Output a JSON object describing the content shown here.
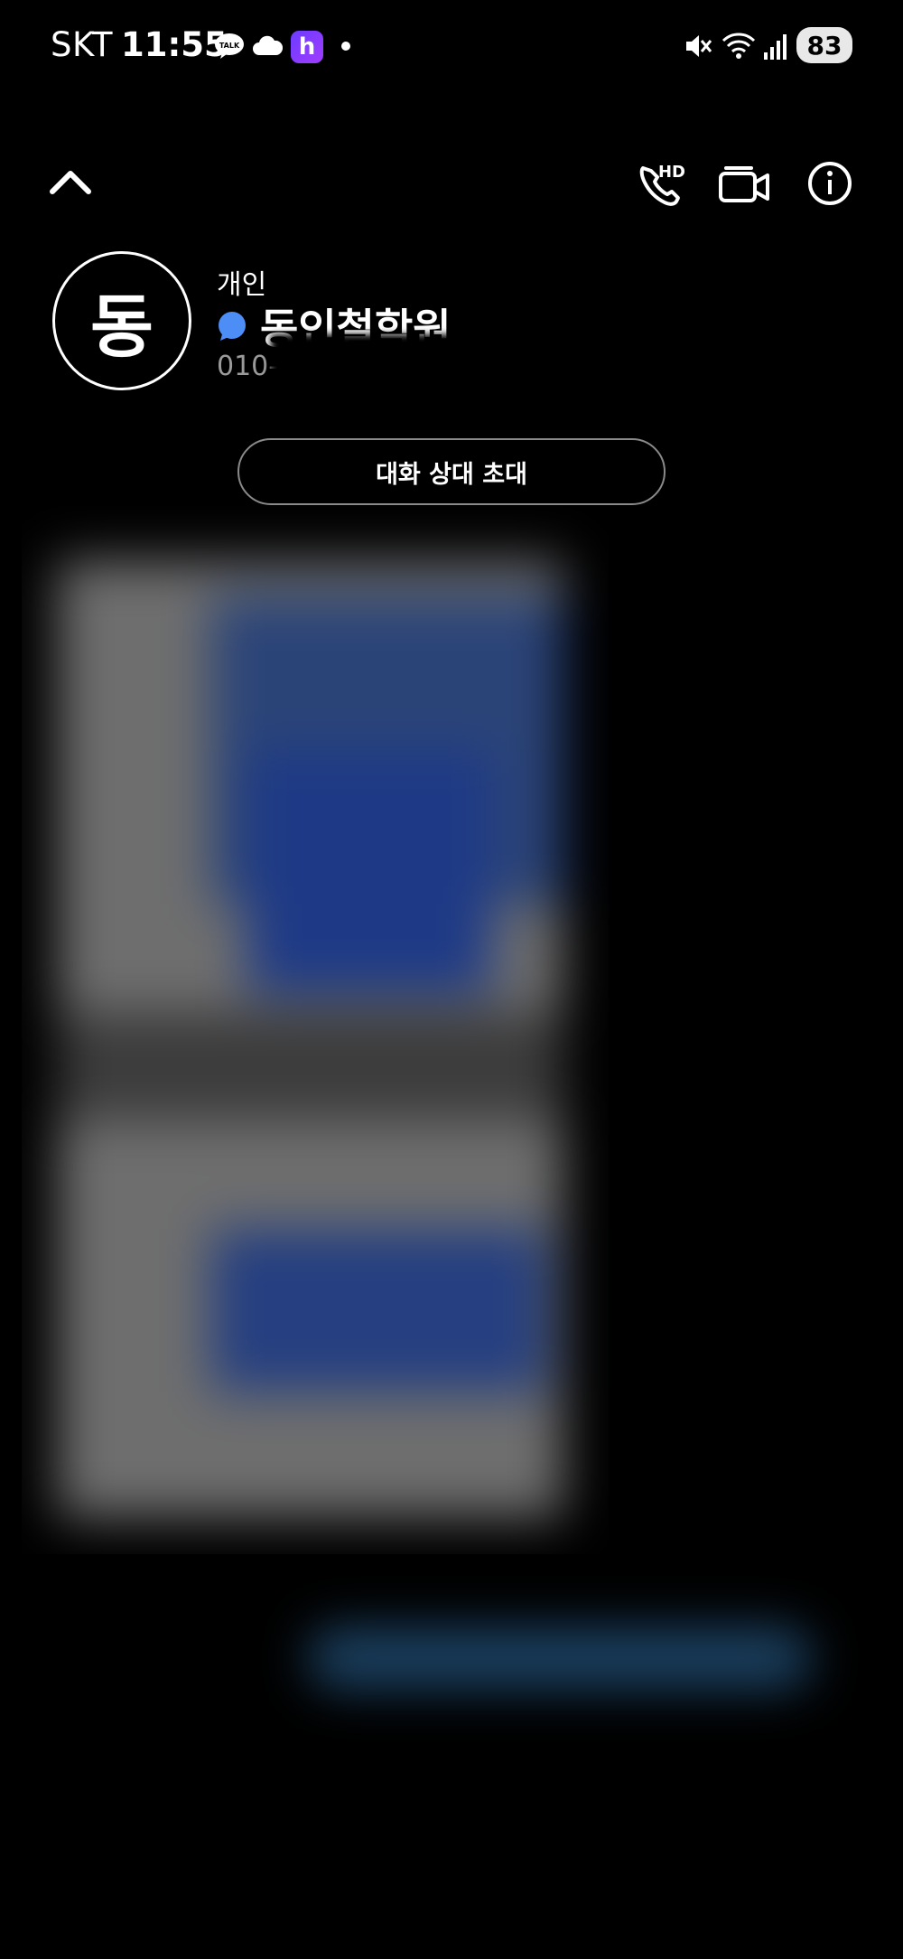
{
  "status_bar": {
    "carrier": "SKT",
    "time": "11:55",
    "talk_icon_label": "TALK",
    "app_badge": "h",
    "battery": "83"
  },
  "header": {
    "icons": [
      "chevron-up-icon",
      "hd-call-icon",
      "video-call-icon",
      "info-icon"
    ]
  },
  "contact": {
    "avatar_initial": "동",
    "type": "개인",
    "name": "동인철학원",
    "phone": "010-"
  },
  "invite_button": {
    "label": "대화 상대 초대"
  },
  "colors": {
    "background": "#000000",
    "chat_bubble": "#4c8df6",
    "battery_bg": "#e8e8e8"
  }
}
